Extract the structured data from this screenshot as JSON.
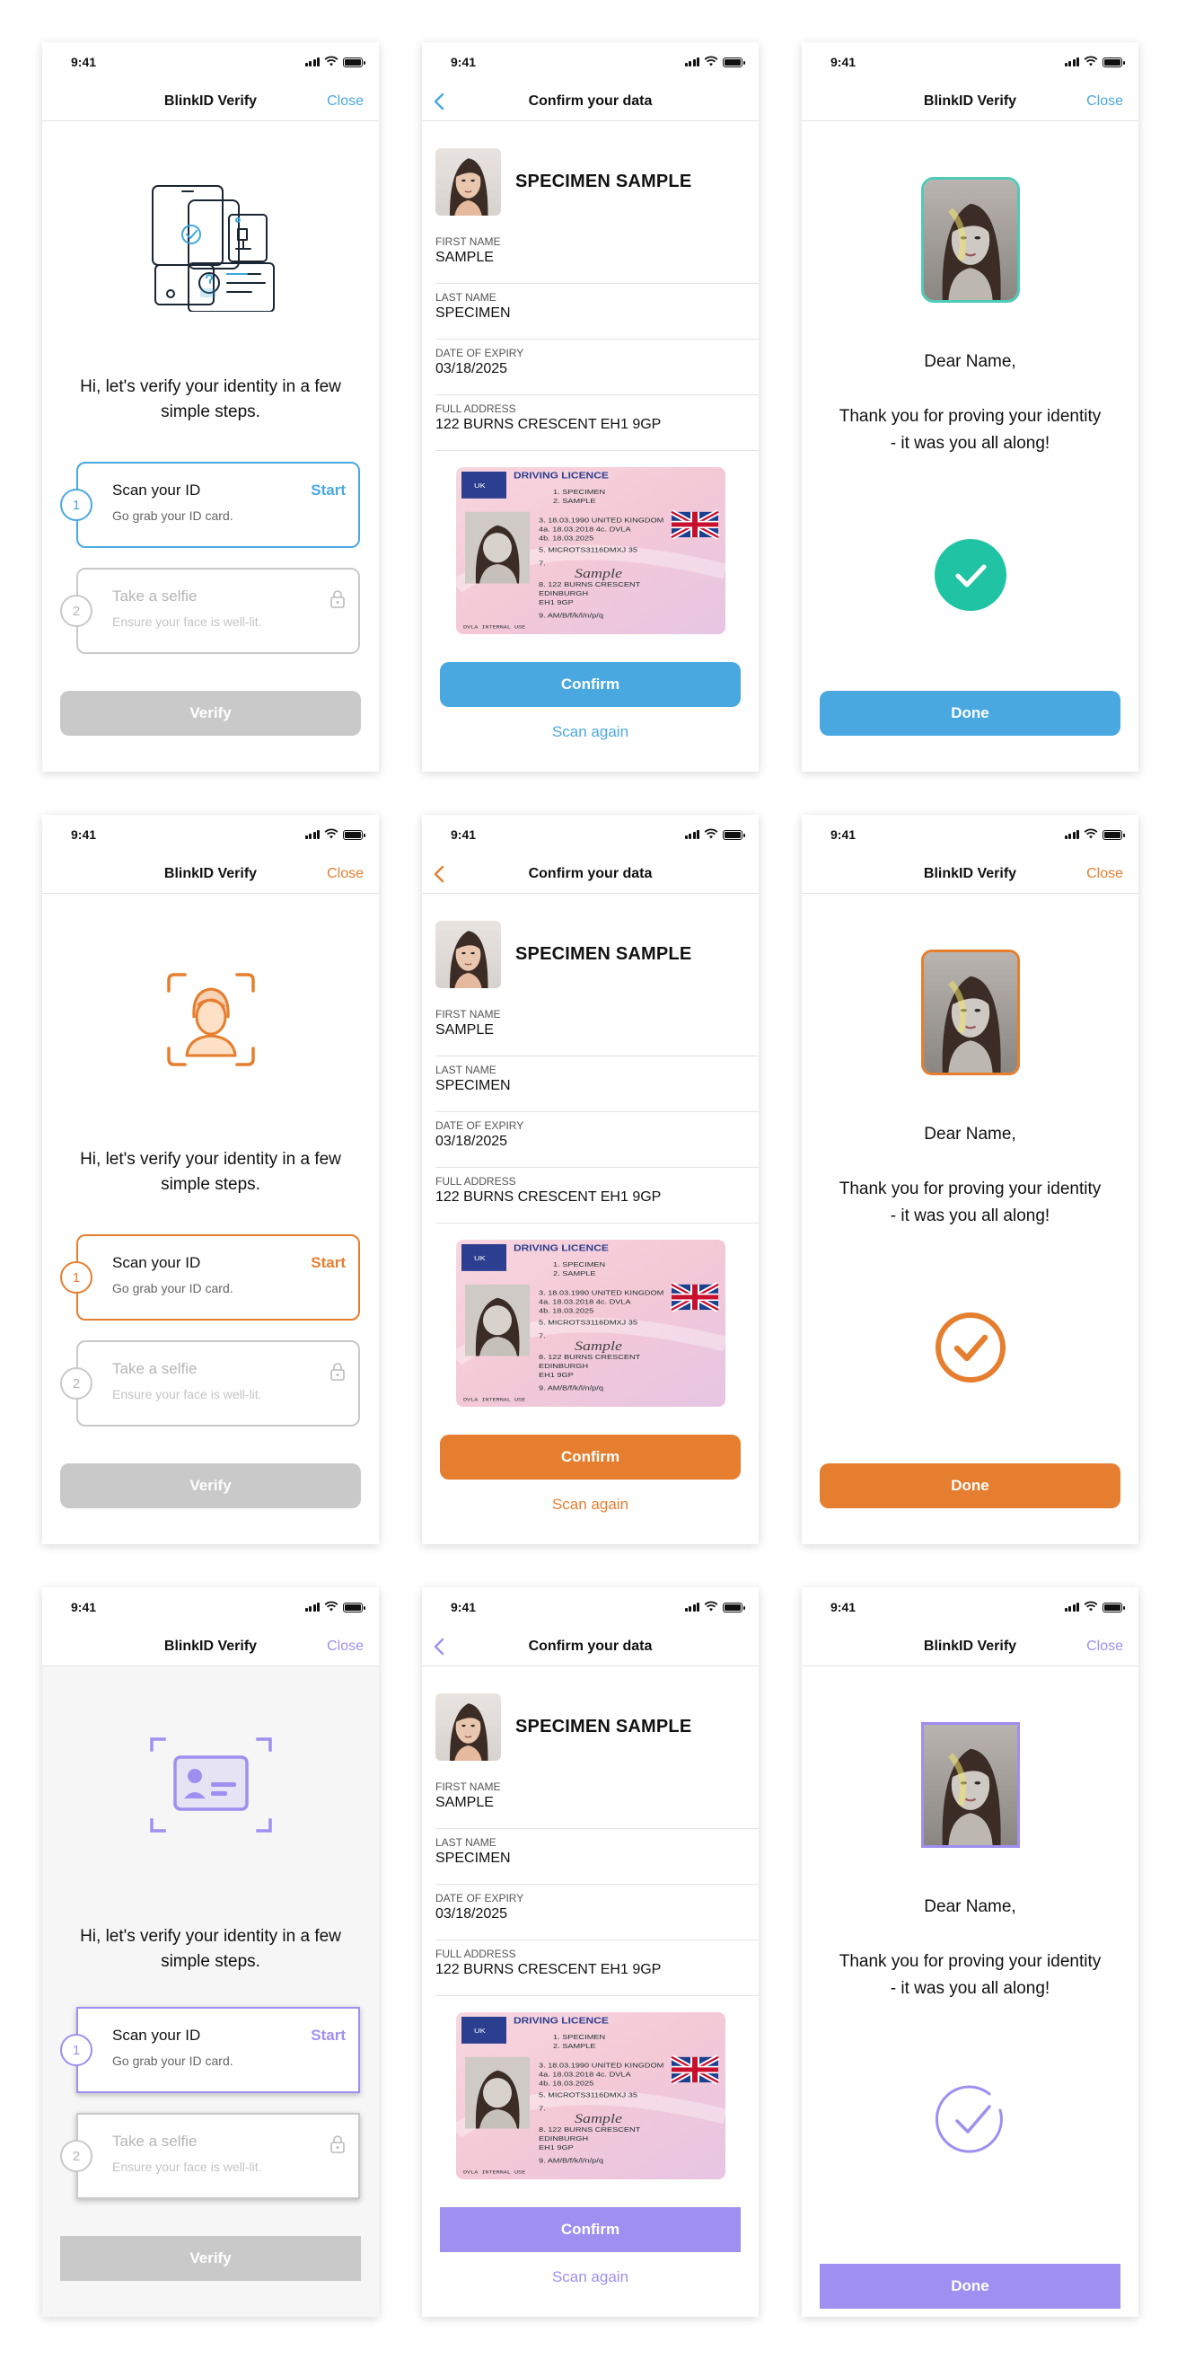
{
  "status": {
    "time": "9:41"
  },
  "intro": {
    "title": "BlinkID Verify",
    "close": "Close",
    "text": "Hi, let's verify your identity in a few simple steps.",
    "step1": {
      "num": "1",
      "title": "Scan your ID",
      "subtitle": "Go grab your ID card.",
      "action": "Start"
    },
    "step2": {
      "num": "2",
      "title": "Take a selfie",
      "subtitle": "Ensure your face is well-lit."
    },
    "button": "Verify"
  },
  "confirm": {
    "title": "Confirm your data",
    "name": "SPECIMEN SAMPLE",
    "fields": [
      {
        "label": "FIRST NAME",
        "value": "SAMPLE"
      },
      {
        "label": "LAST NAME",
        "value": "SPECIMEN"
      },
      {
        "label": "DATE OF EXPIRY",
        "value": "03/18/2025"
      },
      {
        "label": "FULL ADDRESS",
        "value": "122 BURNS CRESCENT EH1 9GP"
      }
    ],
    "card": {
      "heading": "DRIVING LICENCE",
      "country": "UK",
      "lines": [
        "1. SPECIMEN",
        "2. SAMPLE",
        "3. 18.03.1990 UNITED KINGDOM",
        "4a. 18.03.2018   4c. DVLA",
        "4b. 18.03.2025",
        "5. MICROTS3116DMXJ 35",
        "7.",
        "8. 122 BURNS CRESCENT",
        "EDINBURGH",
        "EH1 9GP",
        "9. AM/B/f/k/l/n/p/q"
      ],
      "signature": "Sample",
      "footer": "DVLA INTERNAL USE"
    },
    "button": "Confirm",
    "link": "Scan again"
  },
  "thanks": {
    "title": "BlinkID Verify",
    "close": "Close",
    "dear": "Dear Name,",
    "message": "Thank you for proving your identity - it was you all along!",
    "button": "Done"
  },
  "themes": [
    {
      "name": "blue",
      "accent": "#4aa8e1",
      "check": "#20c3a3"
    },
    {
      "name": "orange",
      "accent": "#e67e2f",
      "check": "#e67e2f"
    },
    {
      "name": "purple",
      "accent": "#9f8ff0",
      "check": "#9f8ff0"
    }
  ],
  "colors": {
    "disabled_button": "#c9c9c9",
    "divider": "#e3e3e3",
    "disabled_text": "#b5b5b5"
  },
  "icons": [
    "back-chevron-icon",
    "lock-icon",
    "check-icon",
    "signal-icon",
    "wifi-icon",
    "battery-icon",
    "devices-illustration",
    "face-scan-icon",
    "id-card-scan-icon"
  ]
}
